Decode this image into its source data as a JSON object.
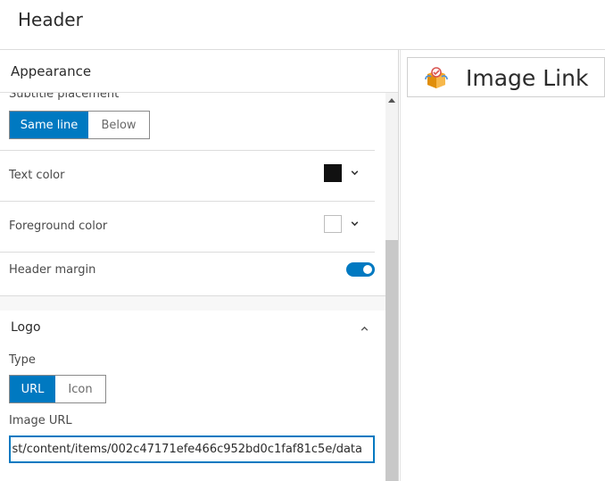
{
  "header": {
    "title": "Header"
  },
  "appearance": {
    "title": "Appearance",
    "subtitle_placement": {
      "label": "Subtitle placement",
      "options": [
        "Same line",
        "Below"
      ],
      "selected": "Same line"
    },
    "text_color": {
      "label": "Text color",
      "value": "#111111"
    },
    "foreground_color": {
      "label": "Foreground color",
      "value": "#ffffff"
    },
    "header_margin": {
      "label": "Header margin",
      "enabled": true
    }
  },
  "logo": {
    "title": "Logo",
    "type": {
      "label": "Type",
      "options": [
        "URL",
        "Icon"
      ],
      "selected": "URL"
    },
    "image_url": {
      "label": "Image URL",
      "value": "st/content/items/002c47171efe466c952bd0c1faf81c5e/data"
    }
  },
  "preview": {
    "title": "Image Link"
  },
  "colors": {
    "accent": "#0079c1"
  }
}
